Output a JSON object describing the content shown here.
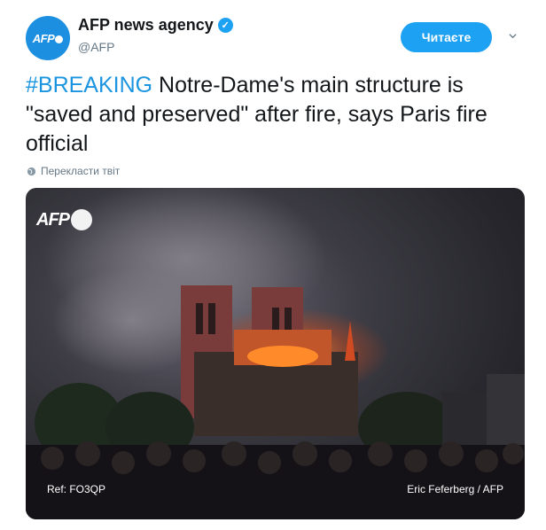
{
  "account": {
    "display_name": "AFP news agency",
    "handle": "@AFP",
    "avatar_text": "AFP",
    "verified": true
  },
  "follow_button": {
    "label": "Читаєте"
  },
  "tweet": {
    "hashtag": "#BREAKING",
    "text": " Notre-Dame's main structure is \"saved and preserved\" after fire, says Paris fire official"
  },
  "translate_link": {
    "label": "Перекласти твіт",
    "icon": "globe-icon"
  },
  "photo": {
    "watermark": "AFP",
    "ref": "Ref: FO3QP",
    "credit": "Eric Feferberg / AFP"
  },
  "colors": {
    "accent": "#1da1f2",
    "hashtag": "#1b95e0",
    "muted": "#657786"
  }
}
